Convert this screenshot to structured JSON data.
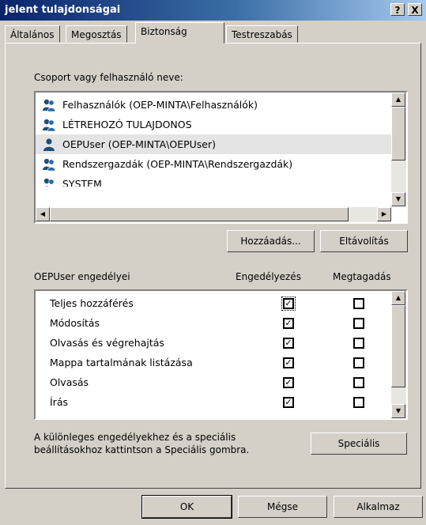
{
  "window": {
    "title": "jelent tulajdonságai",
    "help": "?",
    "close": "X"
  },
  "tabs": [
    {
      "label": "Általános",
      "active": false
    },
    {
      "label": "Megosztás",
      "active": false
    },
    {
      "label": "Biztonság",
      "active": true
    },
    {
      "label": "Testreszabás",
      "active": false
    }
  ],
  "groups": {
    "label": "Csoport vagy felhasználó neve:",
    "items": [
      {
        "name": "Felhasználók (OEP-MINTA\\Felhasználók)",
        "icon": "users-group-icon"
      },
      {
        "name": "LÉTREHOZÓ TULAJDONOS",
        "icon": "users-group-icon"
      },
      {
        "name": "OEPUser (OEP-MINTA\\OEPUser)",
        "icon": "user-icon",
        "selected": true
      },
      {
        "name": "Rendszergazdák (OEP-MINTA\\Rendszergazdák)",
        "icon": "users-group-icon"
      },
      {
        "name": "SYSTEM",
        "icon": "users-group-icon"
      }
    ]
  },
  "buttons": {
    "add": "Hozzáadás...",
    "remove": "Eltávolítás",
    "advanced": "Speciális",
    "ok": "OK",
    "cancel": "Mégse",
    "apply": "Alkalmaz"
  },
  "permissions": {
    "label": "OEPUser engedélyei",
    "allow_header": "Engedélyezés",
    "deny_header": "Megtagadás",
    "items": [
      {
        "name": "Teljes hozzáférés",
        "allow": true,
        "deny": false
      },
      {
        "name": "Módosítás",
        "allow": true,
        "deny": false
      },
      {
        "name": "Olvasás és végrehajtás",
        "allow": true,
        "deny": false
      },
      {
        "name": "Mappa tartalmának listázása",
        "allow": true,
        "deny": false
      },
      {
        "name": "Olvasás",
        "allow": true,
        "deny": false
      },
      {
        "name": "Írás",
        "allow": true,
        "deny": false
      }
    ]
  },
  "info": {
    "line1": "A különleges engedélyekhez és a speciális",
    "line2": "beállításokhoz kattintson a Speciális gombra."
  }
}
